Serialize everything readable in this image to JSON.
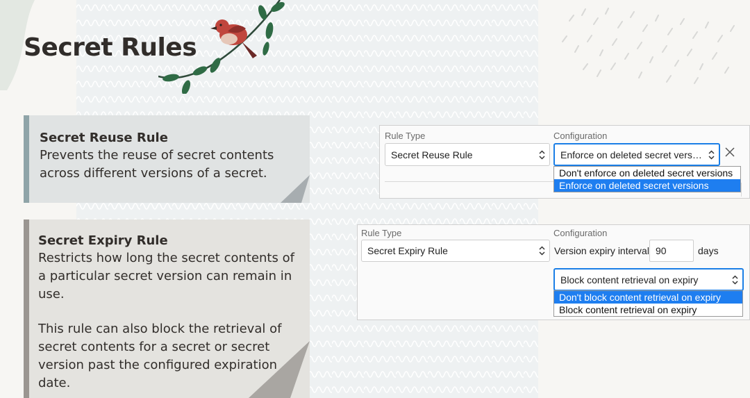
{
  "title": "Secret Rules",
  "reuse_callout": {
    "heading": "Secret Reuse Rule",
    "body": "Prevents the reuse of secret contents across different versions of a secret."
  },
  "expiry_callout": {
    "heading": "Secret Expiry Rule",
    "body1": "Restricts how long the secret contents of a particular secret version can remain in use.",
    "body2": "This rule can also block the retrieval of secret contents for a secret or secret version past the configured expiration date."
  },
  "reuse_panel": {
    "rule_type_label": "Rule Type",
    "configuration_label": "Configuration",
    "rule_type_value": "Secret Reuse Rule",
    "configuration_value": "Enforce on deleted secret vers…",
    "options": [
      {
        "label": "Don't enforce on deleted secret versions",
        "selected": false
      },
      {
        "label": "Enforce on deleted secret versions",
        "selected": true
      }
    ]
  },
  "expiry_panel": {
    "rule_type_label": "Rule Type",
    "configuration_label": "Configuration",
    "rule_type_value": "Secret Expiry Rule",
    "interval_label": "Version expiry interval:",
    "interval_value": "90",
    "interval_unit": "days",
    "retrieval_value": "Block content retrieval on expiry",
    "options": [
      {
        "label": "Don't block content retrieval on expiry",
        "selected": true
      },
      {
        "label": "Block content retrieval on expiry",
        "selected": false
      }
    ]
  },
  "colors": {
    "accent_blue": "#1e7ef0",
    "reuse_bar": "#8fa4a8",
    "expiry_bar": "#9b9691",
    "bird_red": "#c0463d",
    "leaf_green": "#2f6b45"
  },
  "icons": [
    "bird-illustration",
    "close-icon",
    "updown-chevron-icon"
  ]
}
